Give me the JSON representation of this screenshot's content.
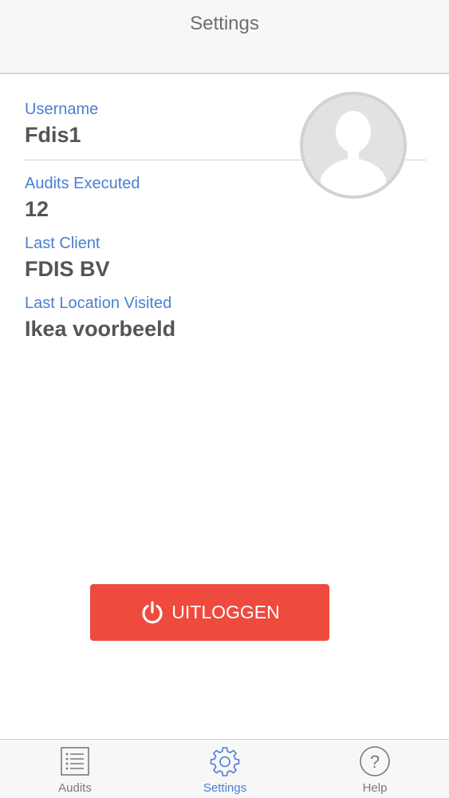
{
  "header": {
    "title": "Settings"
  },
  "profile": {
    "username_label": "Username",
    "username_value": "Fdis1",
    "audits_label": "Audits Executed",
    "audits_value": "12",
    "last_client_label": "Last Client",
    "last_client_value": "FDIS BV",
    "last_location_label": "Last Location Visited",
    "last_location_value": "Ikea voorbeeld",
    "avatar_icon": "user-silhouette-icon"
  },
  "logout": {
    "label": "UITLOGGEN",
    "icon": "power-icon",
    "color": "#ee4a3e"
  },
  "tabbar": {
    "items": [
      {
        "label": "Audits",
        "icon": "list-icon",
        "active": false
      },
      {
        "label": "Settings",
        "icon": "gear-icon",
        "active": true
      },
      {
        "label": "Help",
        "icon": "question-icon",
        "active": false
      }
    ]
  },
  "colors": {
    "accent": "#4a7fd0",
    "value_text": "#555555",
    "nav_background": "#f7f7f8"
  }
}
